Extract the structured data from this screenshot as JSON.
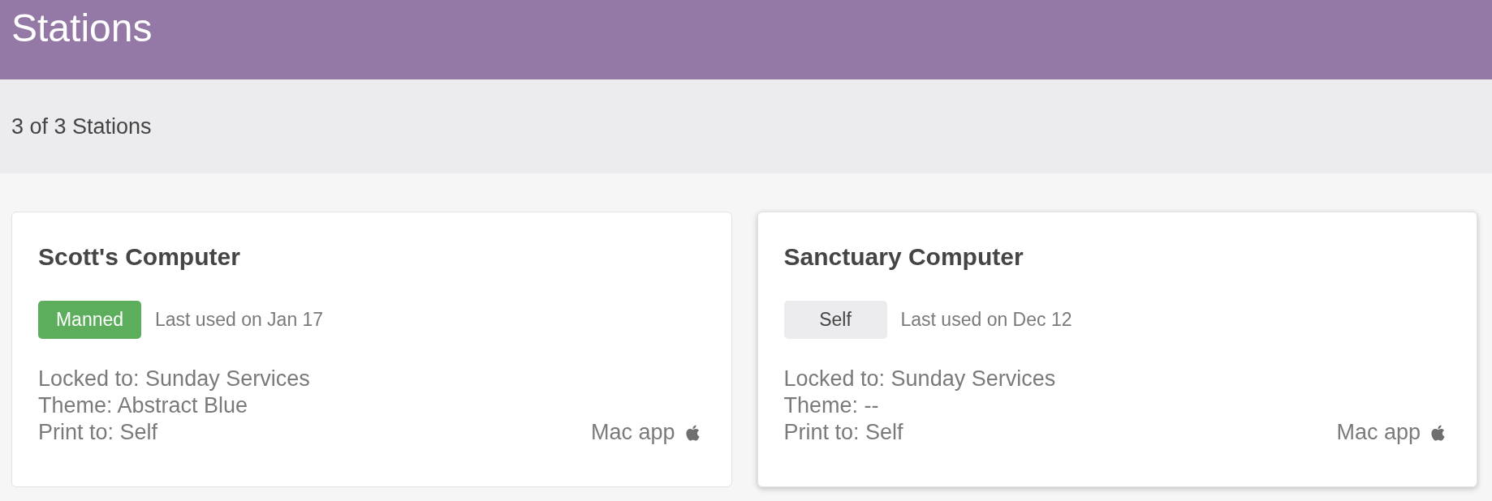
{
  "header": {
    "title": "Stations"
  },
  "summary": {
    "text": "3 of 3 Stations"
  },
  "stations": [
    {
      "name": "Scott's Computer",
      "mode": {
        "label": "Manned",
        "kind": "manned"
      },
      "last_used": "Last used on Jan 17",
      "details": [
        "Locked to: Sunday Services",
        "Theme: Abstract Blue",
        "Print to: Self"
      ],
      "platform": "Mac app",
      "hovered": false
    },
    {
      "name": "Sanctuary Computer",
      "mode": {
        "label": "Self",
        "kind": "self"
      },
      "last_used": "Last used on Dec 12",
      "details": [
        "Locked to: Sunday Services",
        "Theme: --",
        "Print to: Self"
      ],
      "platform": "Mac app",
      "hovered": true
    }
  ]
}
